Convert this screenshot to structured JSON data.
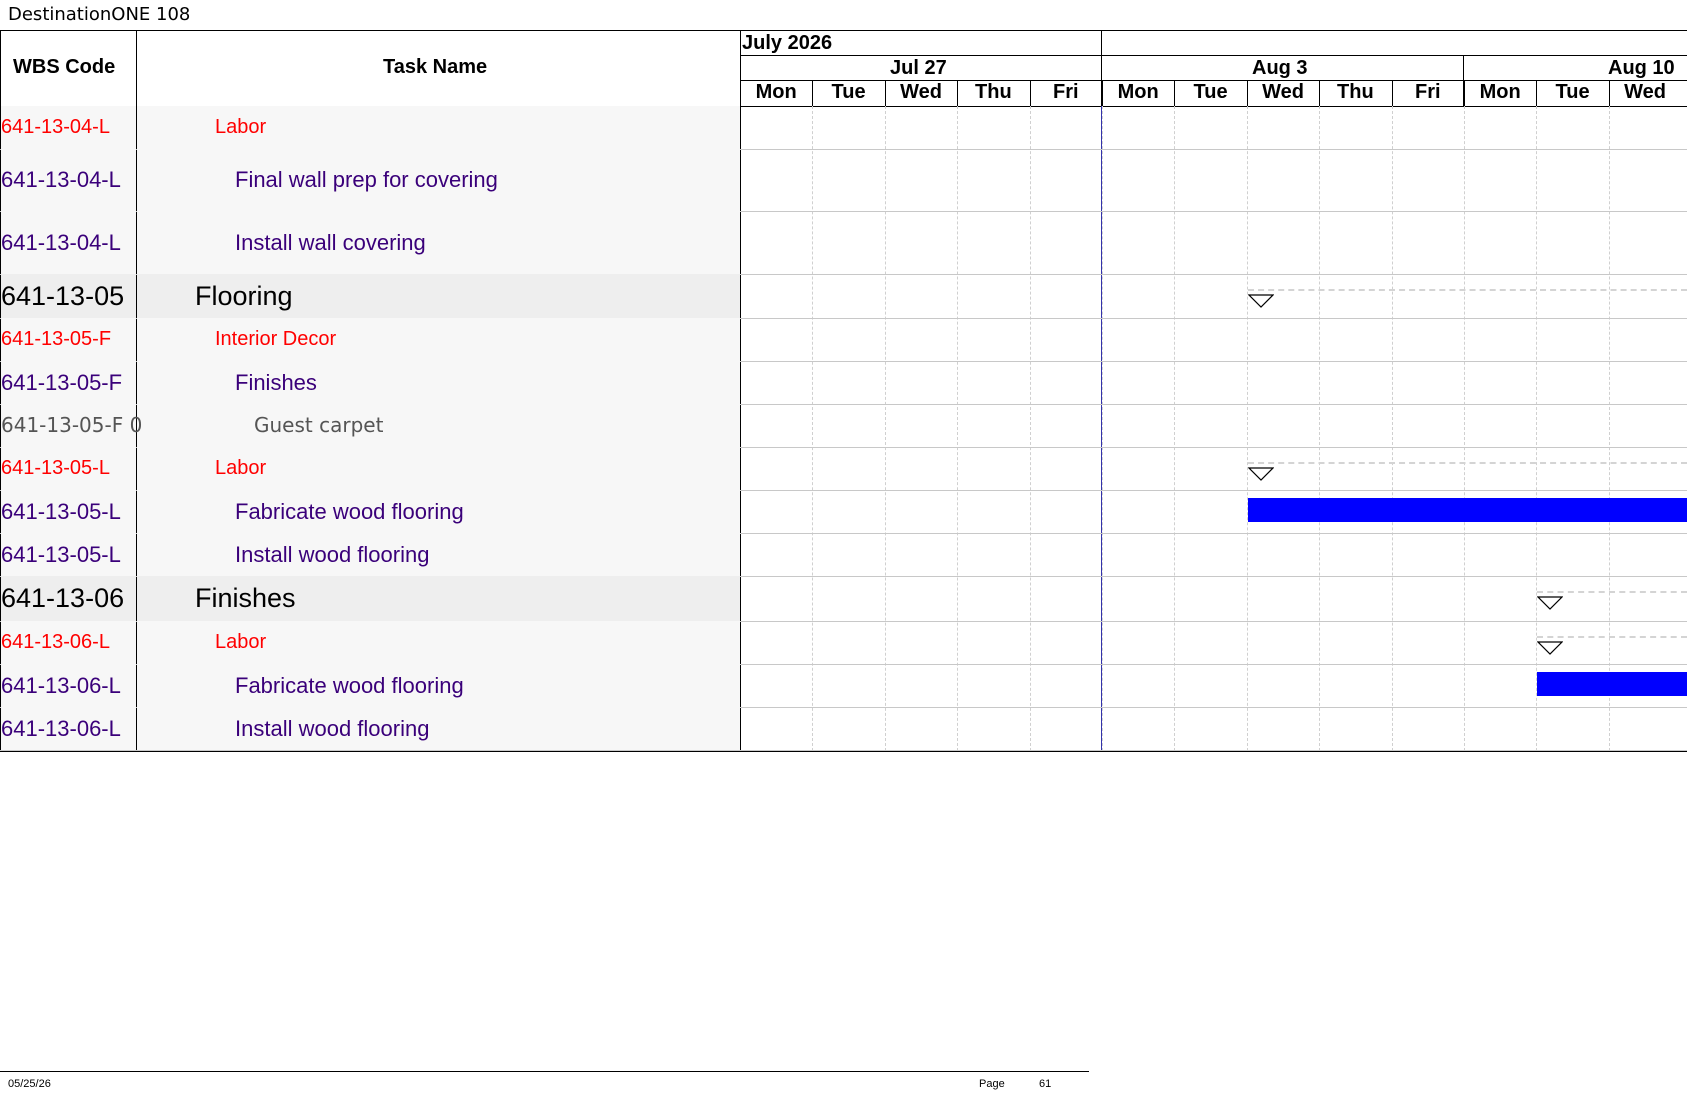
{
  "document": {
    "title": "DestinationONE 108"
  },
  "headers": {
    "wbs": "WBS Code",
    "task": "Task Name"
  },
  "timescale": {
    "months": [
      "July 2026",
      ""
    ],
    "weeks": [
      "Jul 27",
      "Aug 3",
      "Aug 10"
    ],
    "days": [
      "Mon",
      "Tue",
      "Wed",
      "Thu",
      "Fri",
      "Mon",
      "Tue",
      "Wed",
      "Thu",
      "Fri",
      "Mon",
      "Tue",
      "Wed"
    ]
  },
  "rows": [
    {
      "wbs": "641-13-04-L",
      "task": "Labor",
      "style": "labor"
    },
    {
      "wbs": "641-13-04-L",
      "task": "Final wall prep for covering",
      "style": "task"
    },
    {
      "wbs": "641-13-04-L",
      "task": "Install wall covering",
      "style": "task"
    },
    {
      "wbs": "641-13-05",
      "task": "Flooring",
      "style": "summary"
    },
    {
      "wbs": "641-13-05-F",
      "task": "Interior Decor",
      "style": "labor"
    },
    {
      "wbs": "641-13-05-F",
      "task": "Finishes",
      "style": "task"
    },
    {
      "wbs": "641-13-05-F 0",
      "task": "Guest carpet",
      "style": "detail"
    },
    {
      "wbs": "641-13-05-L",
      "task": "Labor",
      "style": "labor"
    },
    {
      "wbs": "641-13-05-L",
      "task": "Fabricate wood flooring",
      "style": "task"
    },
    {
      "wbs": "641-13-05-L",
      "task": "Install wood flooring",
      "style": "task"
    },
    {
      "wbs": "641-13-06",
      "task": "Finishes",
      "style": "summary"
    },
    {
      "wbs": "641-13-06-L",
      "task": "Labor",
      "style": "labor"
    },
    {
      "wbs": "641-13-06-L",
      "task": "Fabricate wood flooring",
      "style": "task"
    },
    {
      "wbs": "641-13-06-L",
      "task": "Install wood flooring",
      "style": "task"
    }
  ],
  "colors": {
    "labor": "#ff0000",
    "task": "#3a007a",
    "summary": "#000000",
    "detail": "#555555",
    "bar": "#0000ff",
    "today_line": "#3333aa"
  },
  "footer": {
    "date": "05/25/26",
    "page_label": "Page",
    "page_number": "61"
  }
}
